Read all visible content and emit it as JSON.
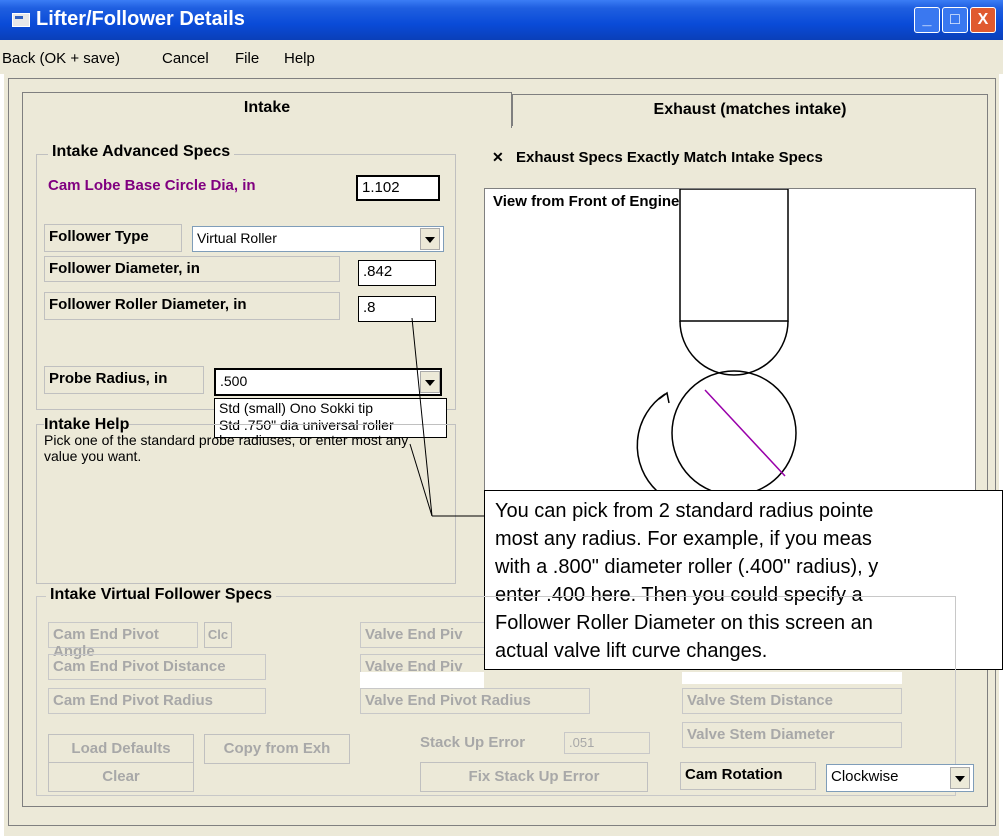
{
  "window": {
    "title": "Lifter/Follower Details",
    "btn_min": "_",
    "btn_max": "□",
    "btn_close": "X"
  },
  "menu": {
    "back": "Back (OK + save)",
    "cancel": "Cancel",
    "file": "File",
    "help": "Help"
  },
  "tabs": {
    "intake": "Intake",
    "exhaust": "Exhaust (matches intake)"
  },
  "advanced": {
    "title": "Intake Advanced Specs",
    "base_circle_label": "Cam Lobe Base Circle Dia, in",
    "base_circle_value": "1.102",
    "follower_type_label": "Follower Type",
    "follower_type_value": "Virtual Roller",
    "follower_dia_label": "Follower Diameter, in",
    "follower_dia_value": ".842",
    "roller_dia_label": "Follower Roller Diameter, in",
    "roller_dia_value": ".8",
    "probe_label": "Probe Radius, in",
    "probe_value": ".500",
    "probe_options": [
      "Std (small) Ono Sokki tip",
      "Std .750\" dia universal roller"
    ]
  },
  "help": {
    "title": "Intake Help",
    "text": "Pick one of the standard probe radiuses, or enter most any value you want."
  },
  "exhaust_match": {
    "check": "✕",
    "label": "Exhaust Specs Exactly Match Intake Specs"
  },
  "view": {
    "label": "View from Front of Engine"
  },
  "callout": {
    "lines": [
      "You can pick from 2 standard radius pointe",
      "most any radius.  For example, if you meas",
      "with a .800\" diameter roller (.400\" radius), y",
      "enter .400 here.  Then you could specify a",
      "Follower Roller Diameter on this screen an",
      "actual valve lift curve changes."
    ]
  },
  "virtual": {
    "title": "Intake Virtual Follower Specs",
    "cam_pivot_angle": "Cam End Pivot Angle",
    "clc": "Clc",
    "cam_pivot_distance": "Cam End Pivot Distance",
    "cam_pivot_radius": "Cam End Pivot Radius",
    "valve_pivot_1": "Valve End Piv",
    "valve_pivot_2": "Valve End Piv",
    "valve_pivot_radius": "Valve End Pivot Radius",
    "valve_stem_distance": "Valve Stem Distance",
    "valve_stem_dia": "Valve Stem Diameter",
    "load_defaults": "Load Defaults",
    "copy_exh": "Copy from Exh",
    "clear": "Clear",
    "stack_label": "Stack Up Error",
    "stack_value": ".051",
    "fix_stack": "Fix Stack Up Error",
    "rotation_label": "Cam Rotation",
    "rotation_value": "Clockwise"
  },
  "colors": {
    "titlebar": "#0a4bd8",
    "purple_label": "#800080",
    "window_bg": "#ece9d8"
  }
}
